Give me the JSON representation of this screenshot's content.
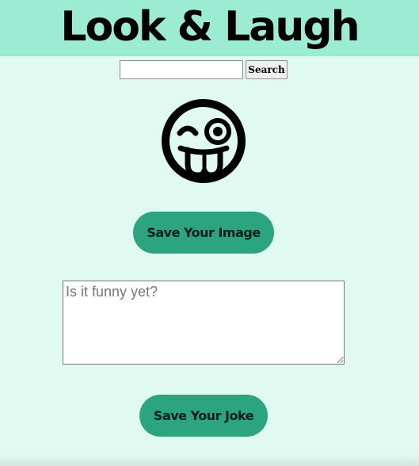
{
  "header": {
    "title": "Look & Laugh",
    "background_color": "#9cecd4"
  },
  "search": {
    "value": "",
    "placeholder": "",
    "button_label": "Search"
  },
  "image": {
    "icon": "winking-face-with-tongue-icon"
  },
  "save_image": {
    "label": "Save Your Image"
  },
  "joke": {
    "value": "",
    "placeholder": "Is it funny yet?"
  },
  "save_joke": {
    "label": "Save Your Joke"
  },
  "colors": {
    "page_background": "#e1faf1",
    "button_background": "#2ba47f"
  }
}
